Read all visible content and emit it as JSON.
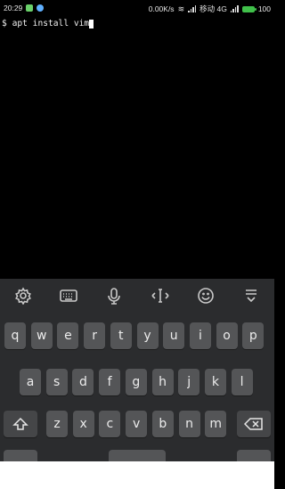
{
  "status_bar": {
    "time": "20:29",
    "net_speed": "0.00K/s",
    "carrier": "移动 4G",
    "battery": "100"
  },
  "terminal": {
    "prompt": "$",
    "command": "apt install vim"
  },
  "toolbar": {
    "items": [
      "settings-icon",
      "keyboard-icon",
      "microphone-icon",
      "cursor-move-icon",
      "emoji-icon",
      "collapse-keyboard-icon"
    ]
  },
  "keyboard": {
    "row1": [
      "q",
      "w",
      "e",
      "r",
      "t",
      "y",
      "u",
      "i",
      "o",
      "p"
    ],
    "row2": [
      "a",
      "s",
      "d",
      "f",
      "g",
      "h",
      "j",
      "k",
      "l"
    ],
    "row3": [
      "z",
      "x",
      "c",
      "v",
      "b",
      "n",
      "m"
    ]
  },
  "colors": {
    "keyboard_bg": "#2b2c2e",
    "key_bg": "#545557",
    "battery": "#40c04a"
  }
}
